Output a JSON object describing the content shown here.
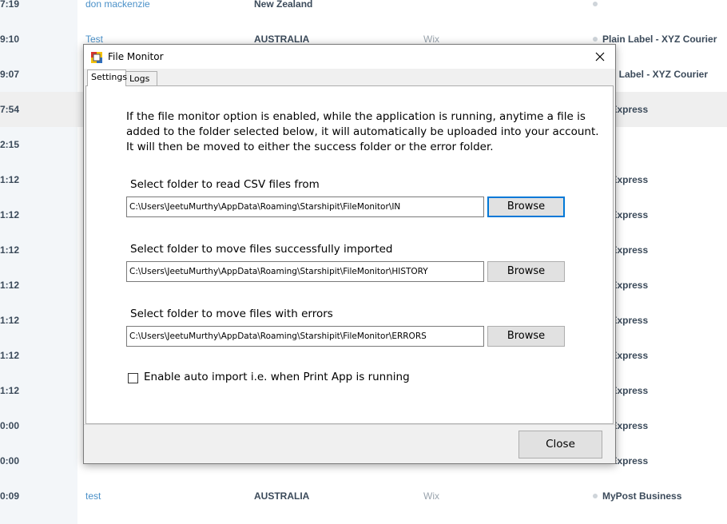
{
  "background_table": {
    "rows": [
      {
        "time": "7:19",
        "name": "don mackenzie",
        "country": "New Zealand",
        "source": "",
        "carrier": ""
      },
      {
        "time": "9:10",
        "name": "Test",
        "country": "AUSTRALIA",
        "source": "Wix",
        "carrier": "Plain Label - XYZ Courier"
      },
      {
        "time": "9:07",
        "name": "",
        "country": "",
        "source": "",
        "carrier": "ain Label - XYZ Courier"
      },
      {
        "time": "7:54",
        "name": "",
        "country": "",
        "source": "",
        "carrier": "L Express"
      },
      {
        "time": "2:15",
        "name": "",
        "country": "",
        "source": "",
        "carrier": ""
      },
      {
        "time": "1:12",
        "name": "",
        "country": "",
        "source": "",
        "carrier": "L Express"
      },
      {
        "time": "1:12",
        "name": "",
        "country": "",
        "source": "",
        "carrier": "L Express"
      },
      {
        "time": "1:12",
        "name": "",
        "country": "",
        "source": "",
        "carrier": "L Express"
      },
      {
        "time": "1:12",
        "name": "",
        "country": "",
        "source": "",
        "carrier": "L Express"
      },
      {
        "time": "1:12",
        "name": "",
        "country": "",
        "source": "",
        "carrier": "L Express"
      },
      {
        "time": "1:12",
        "name": "",
        "country": "",
        "source": "",
        "carrier": "L Express"
      },
      {
        "time": "1:12",
        "name": "",
        "country": "",
        "source": "",
        "carrier": "L Express"
      },
      {
        "time": "0:00",
        "name": "",
        "country": "",
        "source": "",
        "carrier": "L Express"
      },
      {
        "time": "0:00",
        "name": "",
        "country": "",
        "source": "",
        "carrier": "L Express"
      },
      {
        "time": "0:09",
        "name": "test",
        "country": "AUSTRALIA",
        "source": "Wix",
        "carrier": "MyPost Business"
      }
    ]
  },
  "dialog": {
    "title": "File Monitor",
    "tabs": {
      "settings": "Settings",
      "logs": "Logs"
    },
    "intro": [
      "If the file monitor option is enabled, while the application is running, anytime a file is",
      "added to the folder selected below, it will automatically be uploaded into your account.",
      "It will then be moved to either the success folder or the error folder."
    ],
    "read_folder": {
      "label": "Select folder to read CSV files from",
      "path": "C:\\Users\\JeetuMurthy\\AppData\\Roaming\\Starshipit\\FileMonitor\\IN",
      "button": "Browse"
    },
    "success_folder": {
      "label": "Select folder to move files successfully imported",
      "path": "C:\\Users\\JeetuMurthy\\AppData\\Roaming\\Starshipit\\FileMonitor\\HISTORY",
      "button": "Browse"
    },
    "error_folder": {
      "label": "Select folder to move files with errors",
      "path": "C:\\Users\\JeetuMurthy\\AppData\\Roaming\\Starshipit\\FileMonitor\\ERRORS",
      "button": "Browse"
    },
    "auto_import": {
      "label": "Enable auto import i.e. when Print App is running",
      "checked": false
    },
    "close_button": "Close"
  },
  "colors": {
    "link": "#4a90c8",
    "focus": "#0078d7",
    "dialog_bg": "#f0f0f0"
  }
}
